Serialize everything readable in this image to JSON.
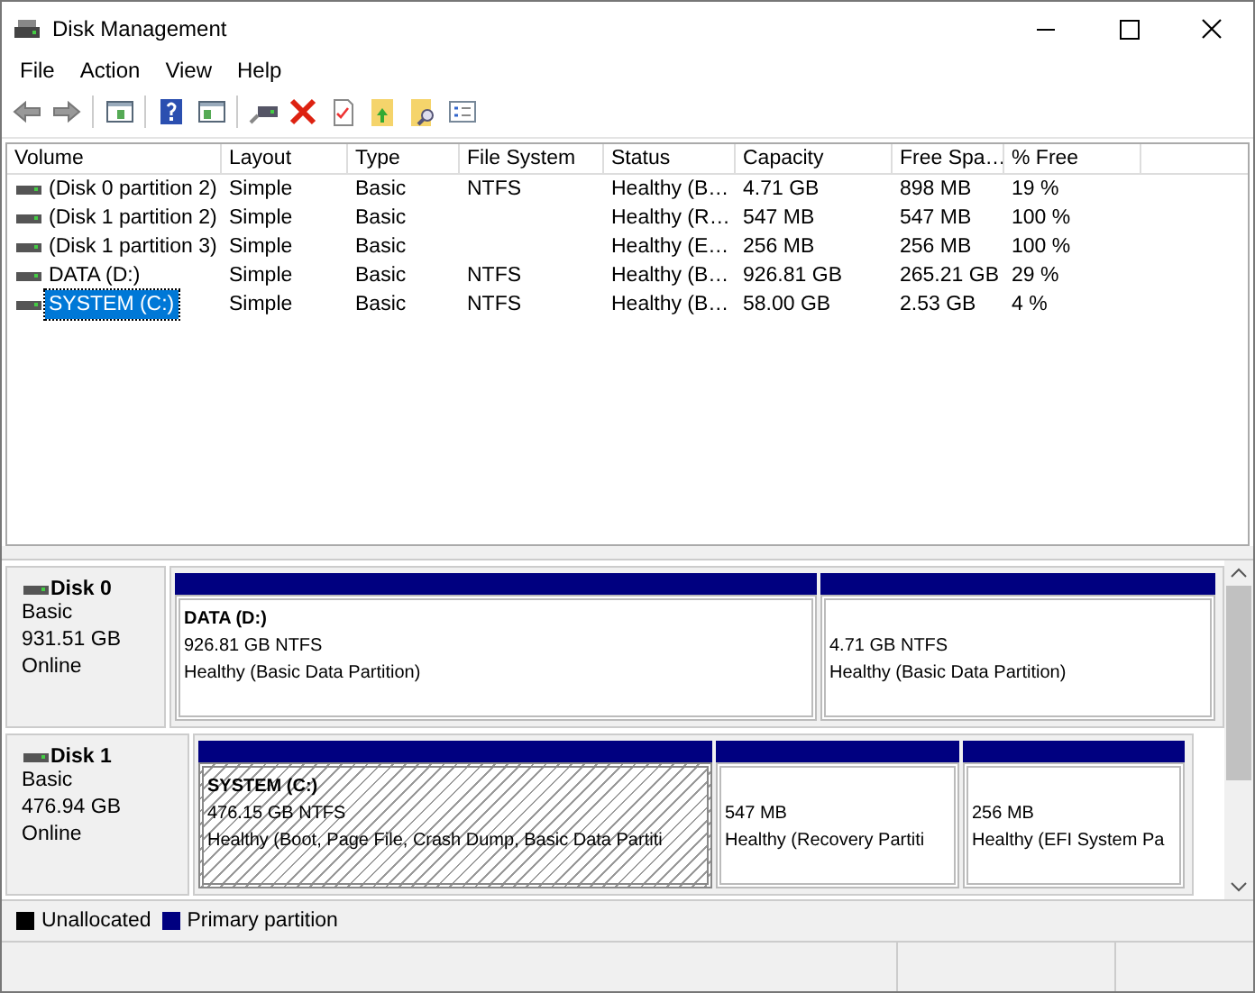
{
  "window": {
    "title": "Disk Management"
  },
  "menu": [
    "File",
    "Action",
    "View",
    "Help"
  ],
  "table": {
    "columns": [
      "Volume",
      "Layout",
      "Type",
      "File System",
      "Status",
      "Capacity",
      "Free Spa…",
      "% Free"
    ],
    "rows": [
      {
        "cells": [
          "(Disk 0 partition 2)",
          "Simple",
          "Basic",
          "NTFS",
          "Healthy (B…",
          "4.71 GB",
          "898 MB",
          "19 %"
        ],
        "selected": false
      },
      {
        "cells": [
          "(Disk 1 partition 2)",
          "Simple",
          "Basic",
          "",
          "Healthy (R…",
          "547 MB",
          "547 MB",
          "100 %"
        ],
        "selected": false
      },
      {
        "cells": [
          "(Disk 1 partition 3)",
          "Simple",
          "Basic",
          "",
          "Healthy (E…",
          "256 MB",
          "256 MB",
          "100 %"
        ],
        "selected": false
      },
      {
        "cells": [
          "DATA (D:)",
          "Simple",
          "Basic",
          "NTFS",
          "Healthy (B…",
          "926.81 GB",
          "265.21 GB",
          "29 %"
        ],
        "selected": false
      },
      {
        "cells": [
          "SYSTEM (C:)",
          "Simple",
          "Basic",
          "NTFS",
          "Healthy (B…",
          "58.00 GB",
          "2.53 GB",
          "4 %"
        ],
        "selected": true
      }
    ]
  },
  "disks": [
    {
      "name": "Disk 0",
      "type": "Basic",
      "size": "931.51 GB",
      "status": "Online",
      "partitions": [
        {
          "title": "DATA  (D:)",
          "size": "926.81 GB NTFS",
          "status": "Healthy (Basic Data Partition)",
          "selected": false
        },
        {
          "size": "4.71 GB NTFS",
          "status": "Healthy (Basic Data Partition)",
          "selected": false
        }
      ]
    },
    {
      "name": "Disk 1",
      "type": "Basic",
      "size": "476.94 GB",
      "status": "Online",
      "partitions": [
        {
          "title": "SYSTEM  (C:)",
          "size": "476.15 GB NTFS",
          "status": "Healthy (Boot, Page File, Crash Dump, Basic Data Partiti",
          "selected": true
        },
        {
          "size": "547 MB",
          "status": "Healthy (Recovery Partiti",
          "selected": false
        },
        {
          "size": "256 MB",
          "status": "Healthy (EFI System Pa",
          "selected": false
        }
      ]
    }
  ],
  "legend": [
    {
      "label": "Unallocated",
      "color": "#000000"
    },
    {
      "label": "Primary partition",
      "color": "#000080"
    }
  ]
}
